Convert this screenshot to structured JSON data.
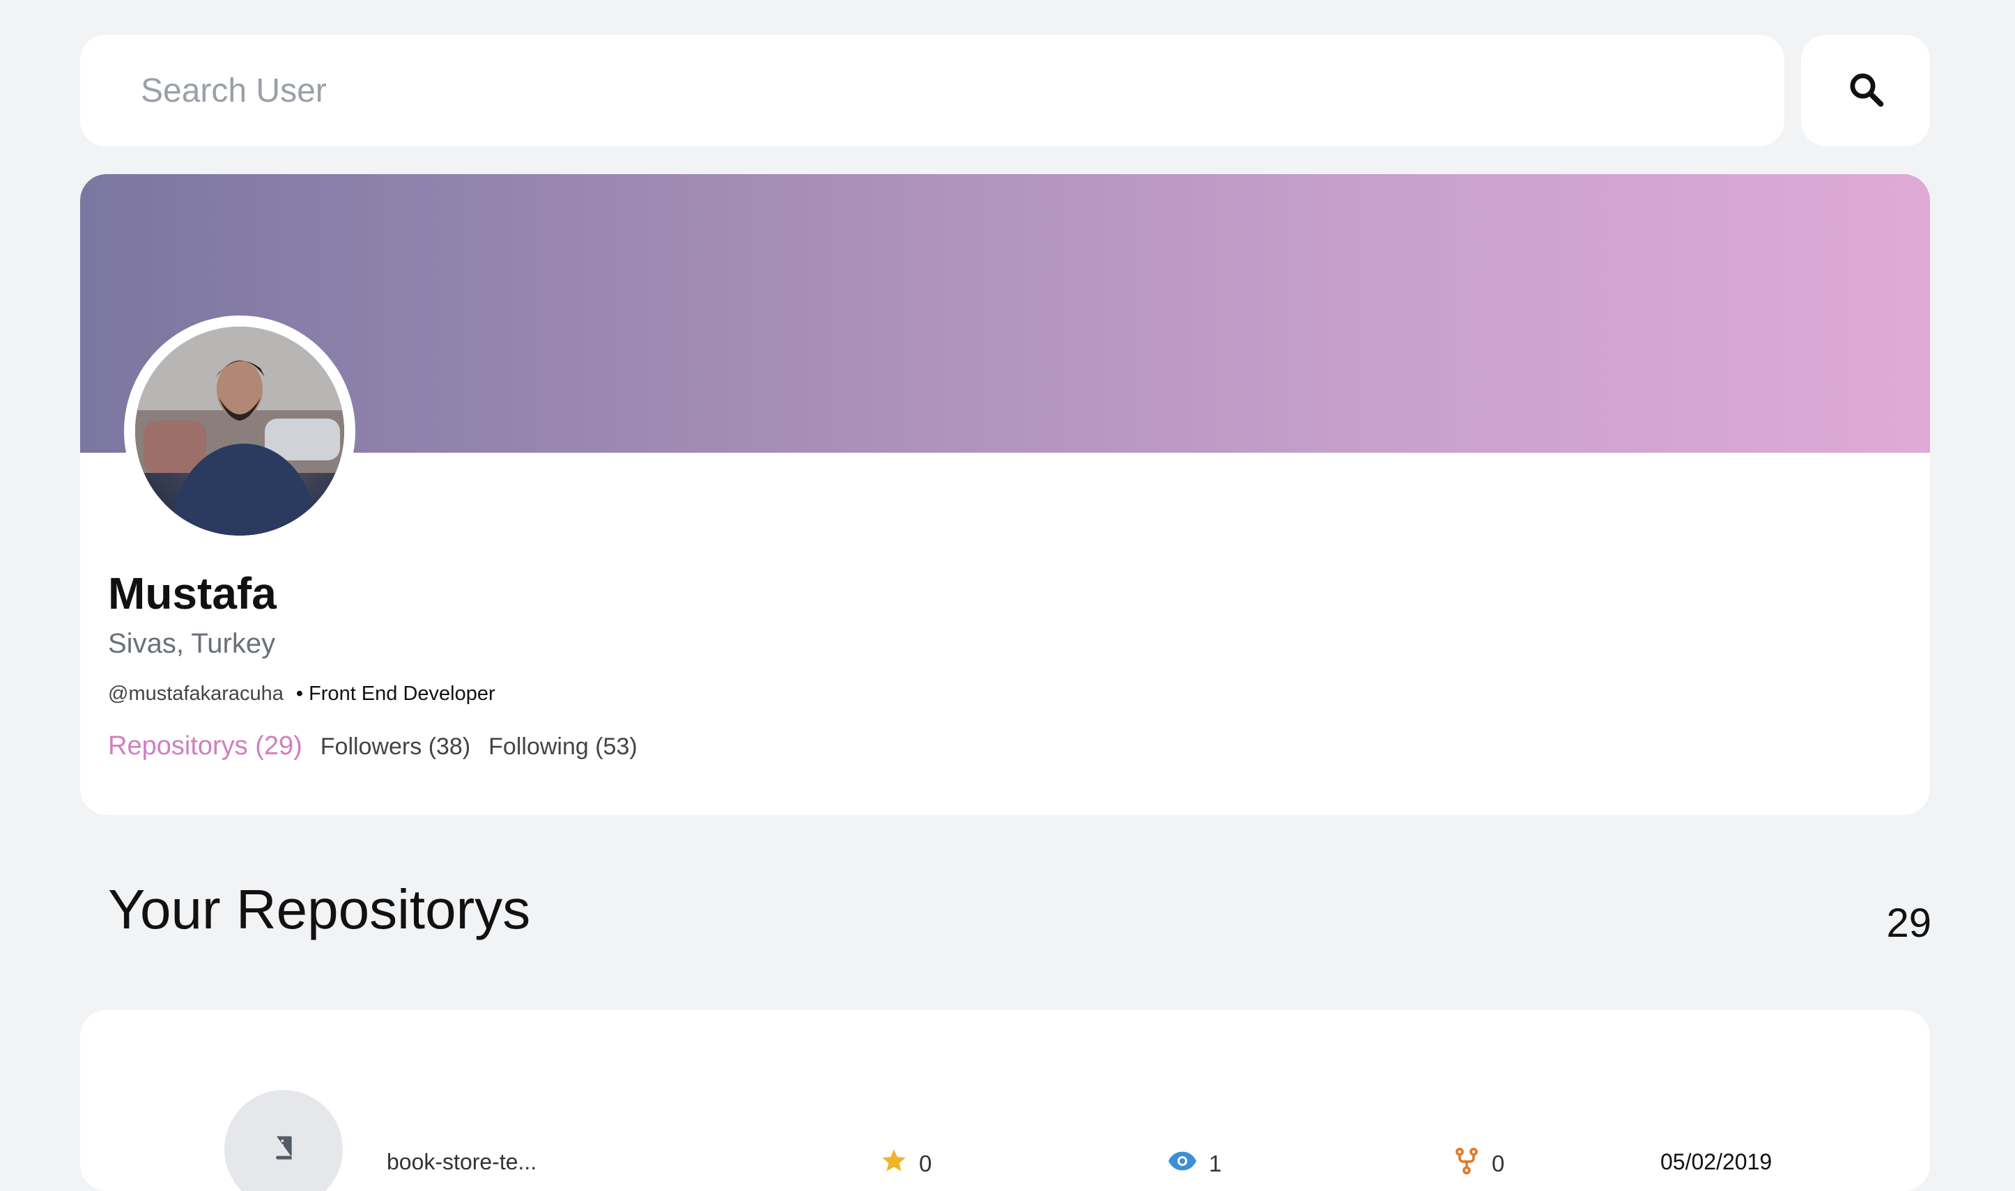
{
  "search": {
    "placeholder": "Search User"
  },
  "profile": {
    "name": "Mustafa",
    "location": "Sivas, Turkey",
    "handle": "@mustafakaracuha",
    "bio_separator": "•",
    "bio": "Front End Developer",
    "tabs": [
      {
        "label": "Repositorys (29)",
        "active": true
      },
      {
        "label": "Followers (38)",
        "active": false
      },
      {
        "label": "Following (53)",
        "active": false
      }
    ],
    "cover_colors": [
      "#7b77a0",
      "#dfaad6"
    ]
  },
  "repos": {
    "title": "Your Repositorys",
    "count": "29",
    "items": [
      {
        "name": "book-store-te...",
        "stars": "0",
        "watchers": "1",
        "forks": "0",
        "date": "05/02/2019",
        "icons": {
          "repo": "book-icon",
          "stars": "star-icon",
          "watchers": "eye-icon",
          "forks": "fork-icon"
        }
      }
    ]
  },
  "colors": {
    "accent": "#d07fc0",
    "star": "#f0b429",
    "eye": "#3a8fd6",
    "fork": "#e07a2a",
    "background": "#f2f3f5"
  }
}
